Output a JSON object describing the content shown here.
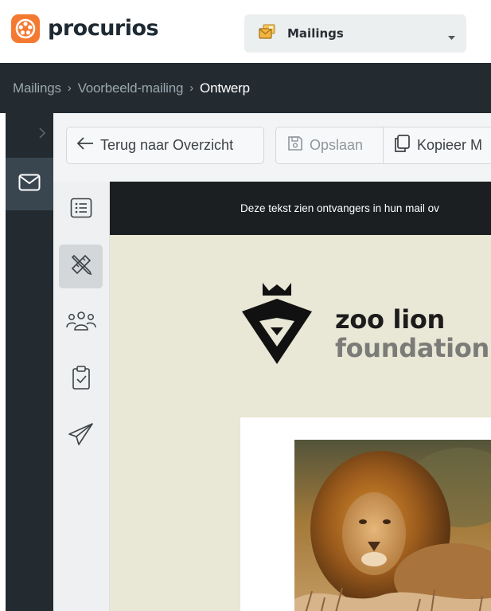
{
  "header": {
    "brand_name": "procurios",
    "module_selector": {
      "selected": "Mailings",
      "icon": "mailings-icon"
    }
  },
  "breadcrumb": {
    "items": [
      "Mailings",
      "Voorbeeld-mailing",
      "Ontwerp"
    ],
    "separator": "›"
  },
  "toolbar": {
    "back_label": "Terug naar Overzicht",
    "save_label": "Opslaan",
    "copy_label": "Kopieer M"
  },
  "side_menu": {
    "items": [
      {
        "icon": "list-icon",
        "active": false
      },
      {
        "icon": "design-tools-icon",
        "active": true
      },
      {
        "icon": "recipients-icon",
        "active": false
      },
      {
        "icon": "clipboard-check-icon",
        "active": false
      },
      {
        "icon": "send-icon",
        "active": false
      }
    ]
  },
  "email": {
    "preheader_text": "Deze tekst zien ontvangers in hun mail ov",
    "logo_line1": "zoo lion",
    "logo_line2": "foundation",
    "hero_image": "lion-photo"
  },
  "colors": {
    "brand_orange": "#f47a31",
    "dark_chrome": "#232b31",
    "email_background": "#e9e7d5"
  }
}
